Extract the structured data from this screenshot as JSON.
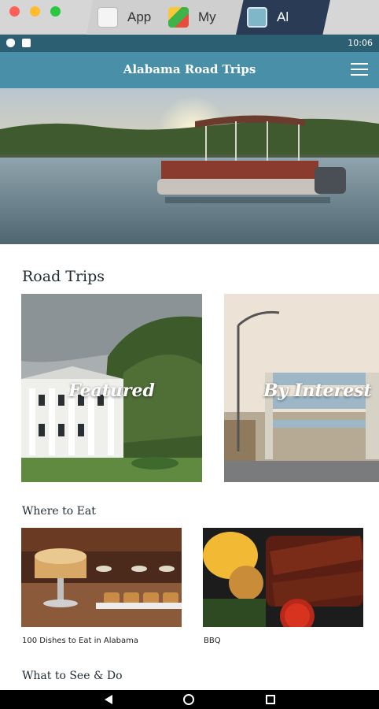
{
  "window": {
    "tabs": [
      {
        "label": "App",
        "icon": "app-store-icon"
      },
      {
        "label": "My",
        "icon": "bluestacks-icon"
      },
      {
        "label": "Al",
        "icon": "alabama-app-icon"
      }
    ]
  },
  "status_bar": {
    "time": "10:06"
  },
  "app": {
    "title": "Alabama Road Trips",
    "menu_icon": "hamburger-menu-icon"
  },
  "sections": {
    "road_trips": {
      "title": "Road Trips",
      "cards": [
        {
          "label": "Featured"
        },
        {
          "label": "By Interest"
        }
      ]
    },
    "where_to_eat": {
      "title": "Where to Eat",
      "items": [
        {
          "caption": "100 Dishes to Eat in Alabama"
        },
        {
          "caption": "BBQ"
        }
      ]
    },
    "what_to_see": {
      "title": "What to See & Do"
    }
  },
  "colors": {
    "header": "#4a8fa8",
    "status_bar": "#2d5f73",
    "title_text": "#1f2a33"
  }
}
